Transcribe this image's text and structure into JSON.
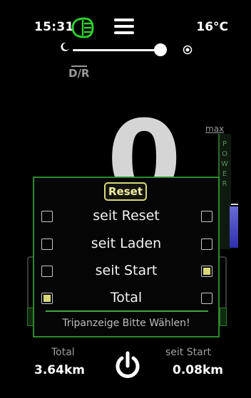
{
  "status": {
    "time": "15:31",
    "temperature": "16°C"
  },
  "mode": {
    "label": "D/R"
  },
  "speed": {
    "value": "0"
  },
  "power_gauge": {
    "max_label": "max",
    "title": "POWER",
    "level": 0.36
  },
  "popup": {
    "reset_label": "Reset",
    "options": [
      {
        "label": "seit Reset",
        "left_checked": false,
        "right_checked": false
      },
      {
        "label": "seit Laden",
        "left_checked": false,
        "right_checked": false
      },
      {
        "label": "seit Start",
        "left_checked": false,
        "right_checked": true
      },
      {
        "label": "Total",
        "left_checked": true,
        "right_checked": false
      }
    ],
    "hint": "Tripanzeige Bitte Wählen!"
  },
  "bottom": {
    "left_label": "Total",
    "left_value": "3.64km",
    "right_label": "seit Start",
    "right_value": "0.08km"
  },
  "icons": [
    "headlight-icon",
    "menu-icon",
    "moon-icon",
    "sun-icon",
    "power-icon"
  ],
  "colors": {
    "accent_green": "#2f8a2f",
    "highlight_yellow": "#d8d878",
    "power_blue": "#3a3ac0"
  }
}
